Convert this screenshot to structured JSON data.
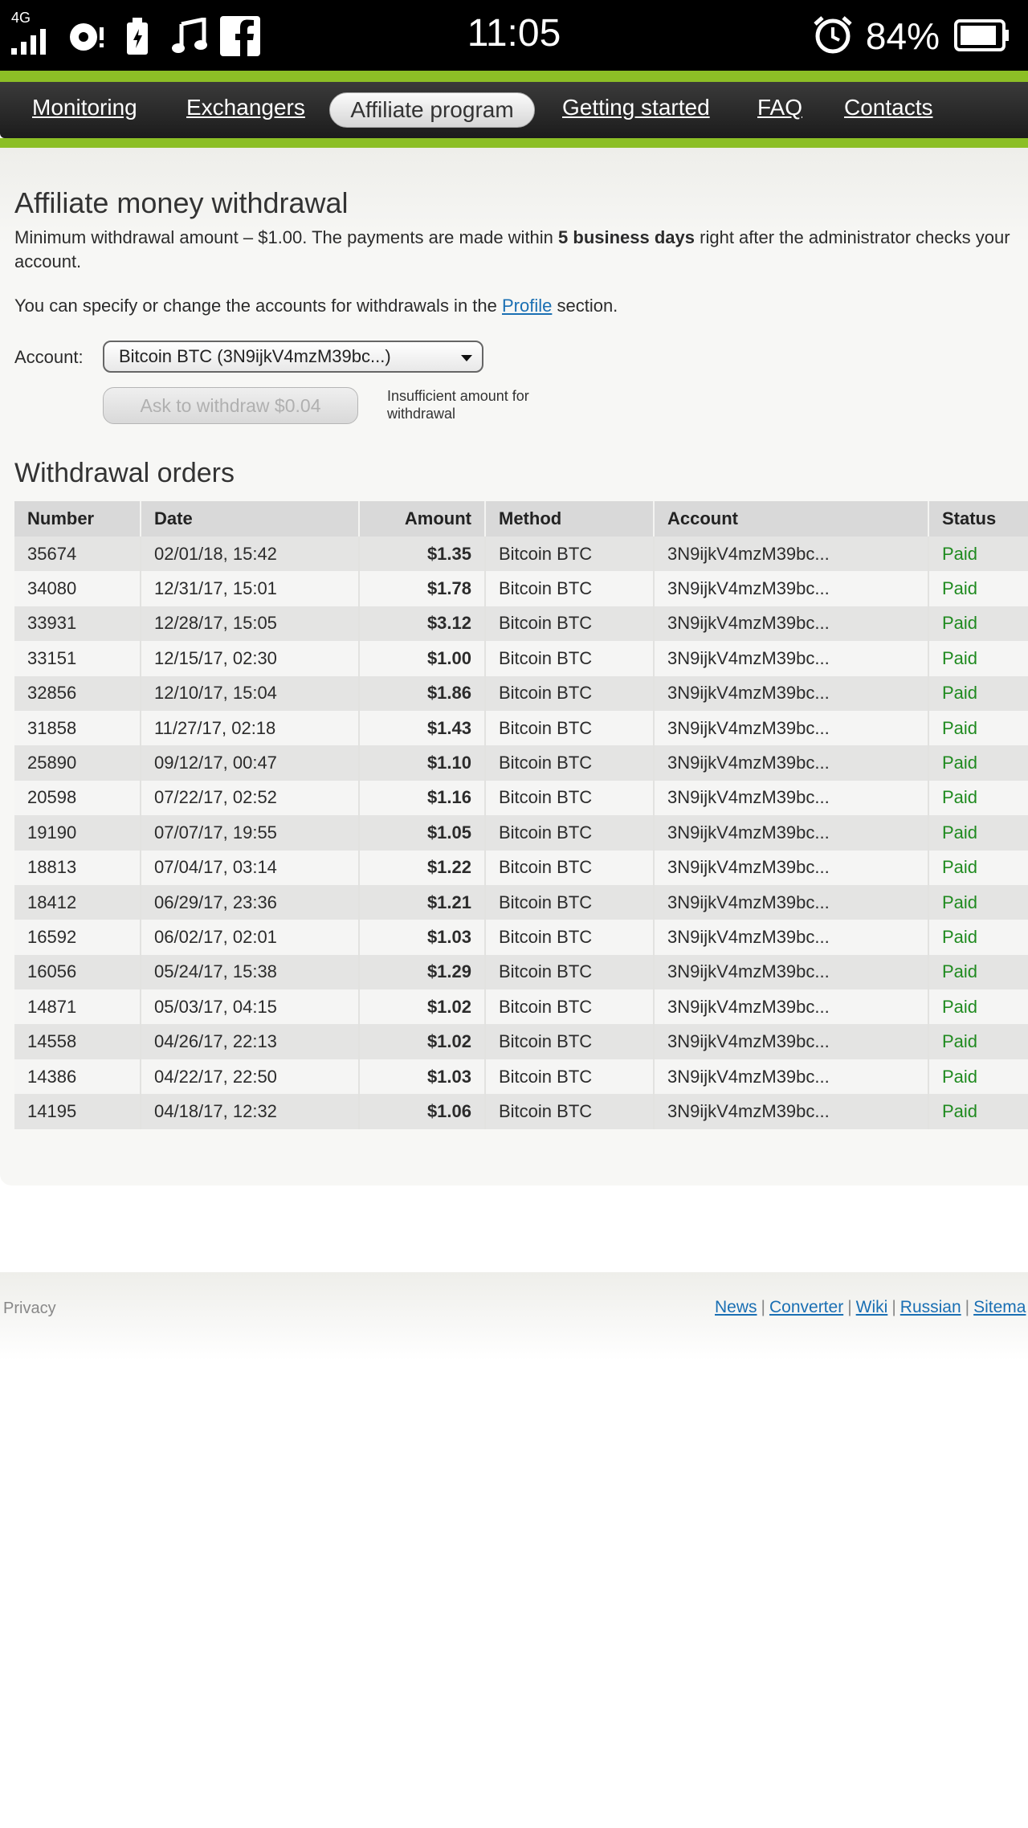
{
  "status_bar": {
    "network": "4G",
    "time": "11:05",
    "battery_percent": "84%",
    "icons": [
      "signal-icon",
      "sync-icon",
      "battery-saver-icon",
      "music-icon",
      "facebook-icon",
      "alarm-icon",
      "battery-icon"
    ]
  },
  "nav": {
    "items": [
      "Monitoring",
      "Exchangers",
      "Affiliate program",
      "Getting started",
      "FAQ",
      "Contacts"
    ],
    "active": "Affiliate program",
    "accent_color": "#8cbf26"
  },
  "withdrawal": {
    "title": "Affiliate money withdrawal",
    "min_text_before": "Minimum withdrawal amount – $1.00. The payments are made within ",
    "min_text_bold": "5 business days",
    "min_text_after": " right after the administrator checks your account.",
    "profile_text_before": "You can specify or change the accounts for withdrawals in the ",
    "profile_link": "Profile",
    "profile_text_after": " section.",
    "account_label": "Account:",
    "account_selected": "Bitcoin BTC (3N9ijkV4mzM39bc...)",
    "withdraw_button": "Ask to withdraw $0.04",
    "insufficient_note": "Insufficient amount for withdrawal"
  },
  "orders": {
    "title": "Withdrawal orders",
    "columns": [
      "Number",
      "Date",
      "Amount",
      "Method",
      "Account",
      "Status"
    ],
    "rows": [
      [
        "35674",
        "02/01/18, 15:42",
        "$1.35",
        "Bitcoin BTC",
        "3N9ijkV4mzM39bc...",
        "Paid"
      ],
      [
        "34080",
        "12/31/17, 15:01",
        "$1.78",
        "Bitcoin BTC",
        "3N9ijkV4mzM39bc...",
        "Paid"
      ],
      [
        "33931",
        "12/28/17, 15:05",
        "$3.12",
        "Bitcoin BTC",
        "3N9ijkV4mzM39bc...",
        "Paid"
      ],
      [
        "33151",
        "12/15/17, 02:30",
        "$1.00",
        "Bitcoin BTC",
        "3N9ijkV4mzM39bc...",
        "Paid"
      ],
      [
        "32856",
        "12/10/17, 15:04",
        "$1.86",
        "Bitcoin BTC",
        "3N9ijkV4mzM39bc...",
        "Paid"
      ],
      [
        "31858",
        "11/27/17, 02:18",
        "$1.43",
        "Bitcoin BTC",
        "3N9ijkV4mzM39bc...",
        "Paid"
      ],
      [
        "25890",
        "09/12/17, 00:47",
        "$1.10",
        "Bitcoin BTC",
        "3N9ijkV4mzM39bc...",
        "Paid"
      ],
      [
        "20598",
        "07/22/17, 02:52",
        "$1.16",
        "Bitcoin BTC",
        "3N9ijkV4mzM39bc...",
        "Paid"
      ],
      [
        "19190",
        "07/07/17, 19:55",
        "$1.05",
        "Bitcoin BTC",
        "3N9ijkV4mzM39bc...",
        "Paid"
      ],
      [
        "18813",
        "07/04/17, 03:14",
        "$1.22",
        "Bitcoin BTC",
        "3N9ijkV4mzM39bc...",
        "Paid"
      ],
      [
        "18412",
        "06/29/17, 23:36",
        "$1.21",
        "Bitcoin BTC",
        "3N9ijkV4mzM39bc...",
        "Paid"
      ],
      [
        "16592",
        "06/02/17, 02:01",
        "$1.03",
        "Bitcoin BTC",
        "3N9ijkV4mzM39bc...",
        "Paid"
      ],
      [
        "16056",
        "05/24/17, 15:38",
        "$1.29",
        "Bitcoin BTC",
        "3N9ijkV4mzM39bc...",
        "Paid"
      ],
      [
        "14871",
        "05/03/17, 04:15",
        "$1.02",
        "Bitcoin BTC",
        "3N9ijkV4mzM39bc...",
        "Paid"
      ],
      [
        "14558",
        "04/26/17, 22:13",
        "$1.02",
        "Bitcoin BTC",
        "3N9ijkV4mzM39bc...",
        "Paid"
      ],
      [
        "14386",
        "04/22/17, 22:50",
        "$1.03",
        "Bitcoin BTC",
        "3N9ijkV4mzM39bc...",
        "Paid"
      ],
      [
        "14195",
        "04/18/17, 12:32",
        "$1.06",
        "Bitcoin BTC",
        "3N9ijkV4mzM39bc...",
        "Paid"
      ]
    ],
    "status_color": "#1f8a1f"
  },
  "footer": {
    "privacy": "Privacy",
    "links": [
      "News",
      "Converter",
      "Wiki",
      "Russian",
      "Sitema"
    ],
    "separator": "|"
  }
}
